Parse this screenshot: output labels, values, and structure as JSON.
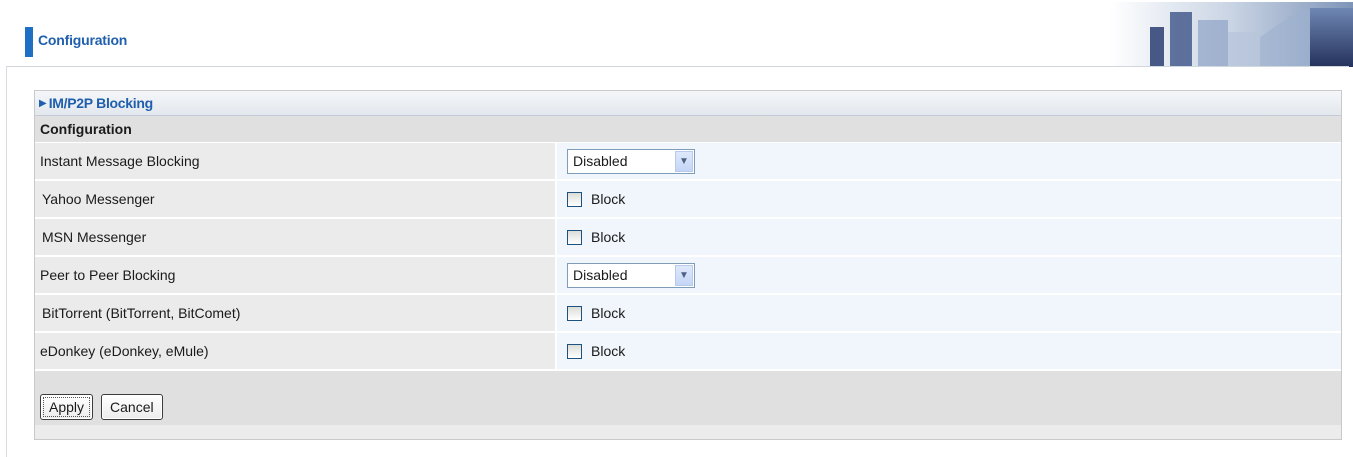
{
  "header": {
    "title": "Configuration"
  },
  "section": {
    "title": "IM/P2P Blocking",
    "subtitle": "Configuration"
  },
  "rows": [
    {
      "label": "Instant Message Blocking",
      "type": "select",
      "value": "Disabled"
    },
    {
      "label": "Yahoo Messenger",
      "type": "checkbox",
      "option": "Block",
      "checked": false
    },
    {
      "label": "MSN Messenger",
      "type": "checkbox",
      "option": "Block",
      "checked": false
    },
    {
      "label": "Peer to Peer Blocking",
      "type": "select",
      "value": "Disabled"
    },
    {
      "label": "BitTorrent (BitTorrent, BitComet)",
      "type": "checkbox",
      "option": "Block",
      "checked": false
    },
    {
      "label": "eDonkey (eDonkey, eMule)",
      "type": "checkbox",
      "option": "Block",
      "checked": false
    }
  ],
  "buttons": {
    "apply": "Apply",
    "cancel": "Cancel"
  },
  "icons": {
    "section_arrow": "triangle-right-icon",
    "select_arrow": "chevron-down-icon"
  },
  "colors": {
    "accent": "#1f6fc5",
    "title_text": "#1f5fad",
    "value_cell": "#f0f6fc",
    "label_cell": "#ebebeb"
  }
}
